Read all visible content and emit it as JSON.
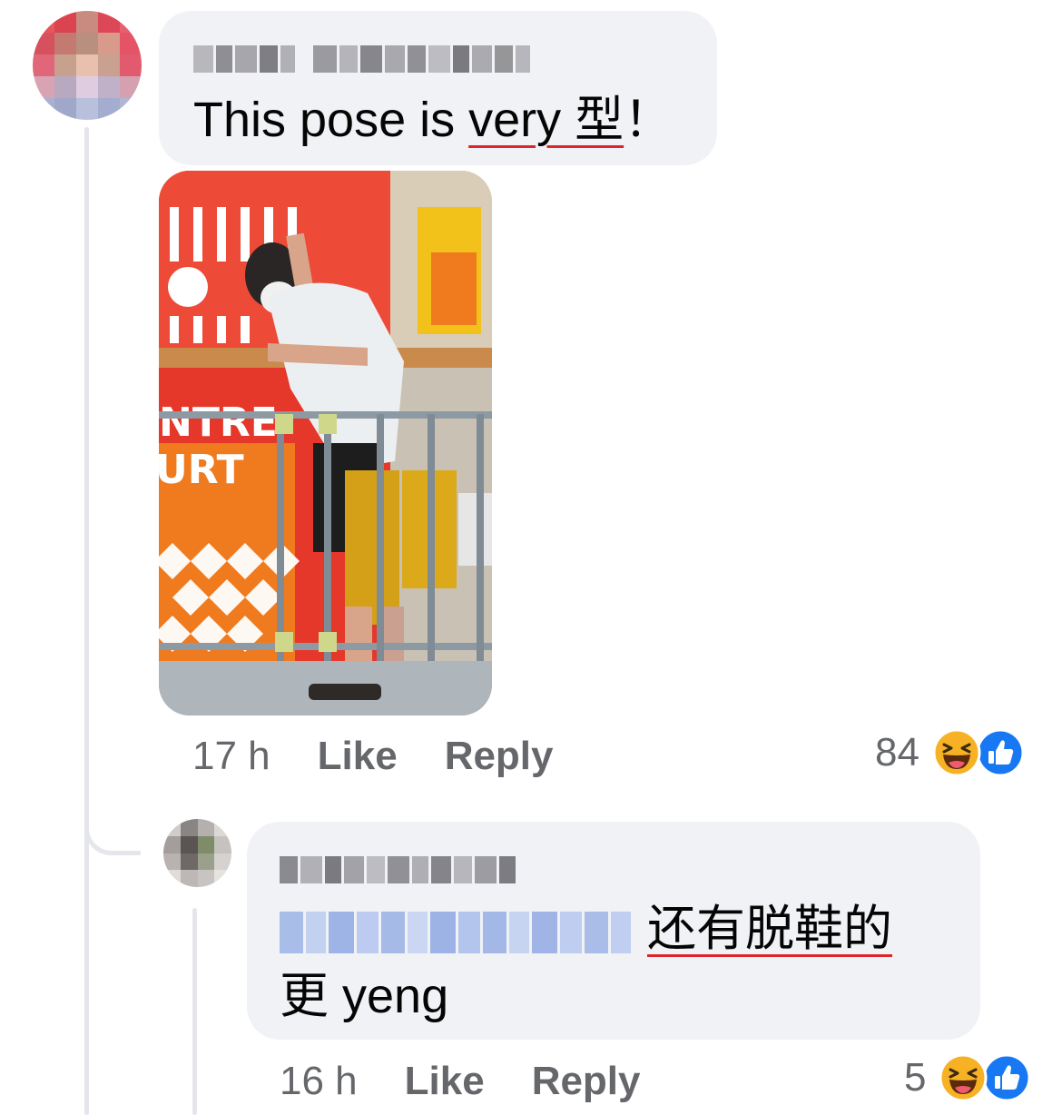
{
  "comments": [
    {
      "author": "",
      "text_before": "This pose is ",
      "text_underlined": "very 型",
      "text_after": "！",
      "time": "17 h",
      "like_label": "Like",
      "reply_label": "Reply",
      "reaction_count": "84",
      "reaction_icons": [
        "haha-icon",
        "like-icon"
      ]
    },
    {
      "author": "",
      "mention": "",
      "text_underlined": "还有脱鞋的",
      "text_line2": "更 yeng",
      "time": "16 h",
      "like_label": "Like",
      "reply_label": "Reply",
      "reaction_count": "5",
      "reaction_icons": [
        "haha-icon",
        "like-icon"
      ]
    }
  ],
  "photo_overlay_text": [
    "NTRE",
    "URT"
  ],
  "colors": {
    "bubble": "#f0f2f5",
    "meta_text": "#65676b",
    "thread_line": "#e4e6eb",
    "underline": "#e0242b",
    "like_blue": "#1877f2",
    "haha_yellow": "#f7b125"
  }
}
